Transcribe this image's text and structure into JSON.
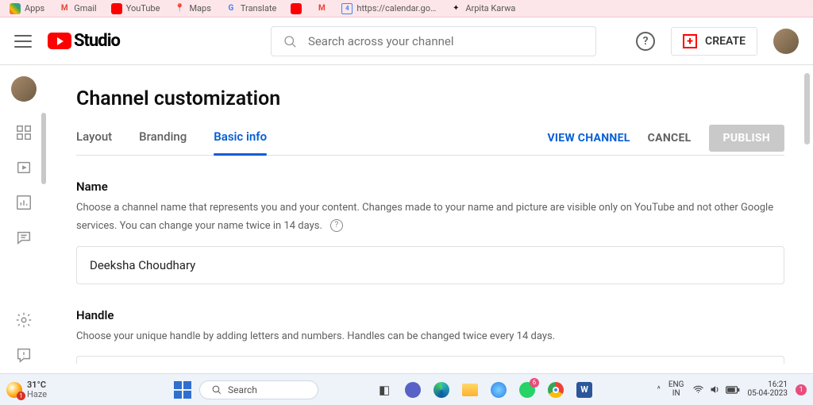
{
  "bookmarks": [
    {
      "label": "Apps",
      "icon": "grid",
      "color": "#ea4335"
    },
    {
      "label": "Gmail",
      "icon": "m",
      "color": "#ea4335"
    },
    {
      "label": "YouTube",
      "icon": "yt",
      "color": "#ff0000"
    },
    {
      "label": "Maps",
      "icon": "pin",
      "color": "#34a853"
    },
    {
      "label": "Translate",
      "icon": "g",
      "color": "#4285f4"
    },
    {
      "label": "",
      "icon": "yt",
      "color": "#ff0000"
    },
    {
      "label": "",
      "icon": "m",
      "color": "#ea4335"
    },
    {
      "label": "https://calendar.go…",
      "icon": "cal",
      "color": "#4285f4"
    },
    {
      "label": "Arpita Karwa",
      "icon": "dot",
      "color": "#111"
    }
  ],
  "appbar": {
    "brand": "Studio",
    "search_placeholder": "Search across your channel",
    "create": "CREATE"
  },
  "page": {
    "title": "Channel customization",
    "tabs": [
      "Layout",
      "Branding",
      "Basic info"
    ],
    "active_tab": 2,
    "actions": {
      "view": "VIEW CHANNEL",
      "cancel": "CANCEL",
      "publish": "PUBLISH"
    },
    "name_section": {
      "label": "Name",
      "desc": "Choose a channel name that represents you and your content. Changes made to your name and picture are visible only on YouTube and not other Google services. You can change your name twice in 14 days.",
      "value": "Deeksha Choudhary"
    },
    "handle_section": {
      "label": "Handle",
      "desc": "Choose your unique handle by adding letters and numbers. Handles can be changed twice every 14 days."
    }
  },
  "taskbar": {
    "weather": {
      "temp": "31°C",
      "cond": "Haze"
    },
    "search_placeholder": "Search",
    "lang": {
      "top": "ENG",
      "bottom": "IN"
    },
    "time": "16:21",
    "date": "05-04-2023",
    "notif": "1",
    "chevron": "^"
  }
}
